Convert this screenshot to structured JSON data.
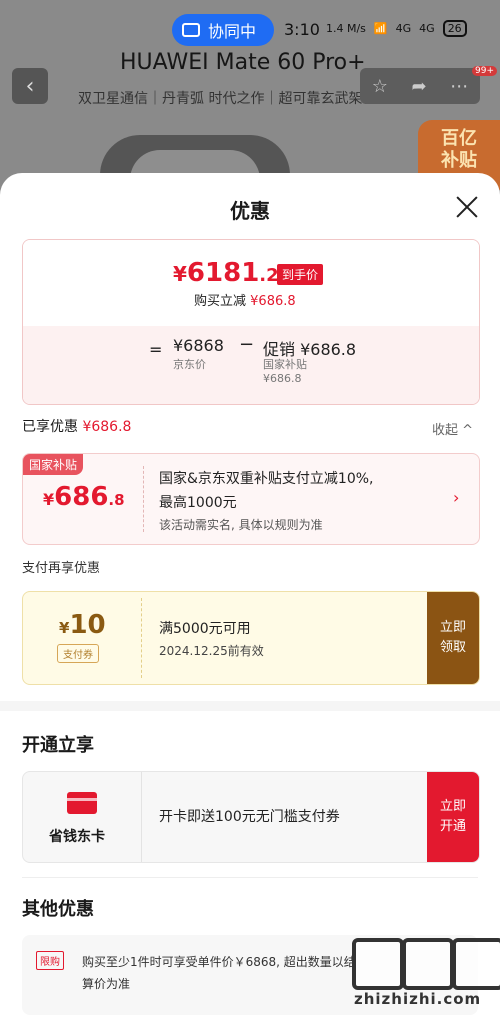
{
  "status_bar": {
    "collab_label": "协同中",
    "time": "3:10",
    "net_speed": "1.4 M/s",
    "signal_1": "4G",
    "signal_2": "4G",
    "battery": "26"
  },
  "background_page": {
    "product_title": "HUAWEI Mate 60 Pro+",
    "subtitle": "双卫星通信｜丹青弧 时代之作｜超可靠玄武架构",
    "badge": "99+",
    "promo_badge_line1": "百亿",
    "promo_badge_line2": "补贴"
  },
  "sheet": {
    "title": "优惠",
    "price_summary": {
      "price_int": "6181",
      "price_dec": ".2",
      "yen": "¥",
      "final_tag": "到手价",
      "instant_label": "购买立减",
      "instant_value": "¥686.8",
      "equals": "=",
      "original_price": "¥6868",
      "original_label": "京东价",
      "minus": "−",
      "promo_line": "促销 ¥686.8",
      "promo_sub1": "国家补贴",
      "promo_sub2": "¥686.8"
    },
    "enjoyed": {
      "label": "已享优惠",
      "value": "¥686.8",
      "collapse": "收起 ^"
    },
    "subsidy": {
      "tag": "国家补贴",
      "amount_int": "686",
      "amount_dec": ".8",
      "line1": "国家&京东双重补贴支付立减10%,",
      "line2": "最高1000元",
      "line3": "该活动需实名, 具体以规则为准",
      "arrow": "›"
    },
    "pay_more_label": "支付再享优惠",
    "coupon": {
      "amount": "10",
      "tag": "支付券",
      "line1": "满5000元可用",
      "line2": "2024.12.25前有效",
      "button_line1": "立即",
      "button_line2": "领取"
    },
    "open_section": {
      "title": "开通立享",
      "card_name": "省钱东卡",
      "text": "开卡即送100元无门槛支付券",
      "button_line1": "立即",
      "button_line2": "开通"
    },
    "other_section": {
      "title": "其他优惠",
      "tag": "限购",
      "line1": "购买至少1件时可享受单件价￥6868, 超出数量以结",
      "line2": "算价为准"
    }
  },
  "watermark": {
    "text": "zhizhizhi.com"
  },
  "colors": {
    "accent_red": "#e3192f",
    "coupon_brown": "#8b5413",
    "collab_blue": "#1f6cf3"
  }
}
